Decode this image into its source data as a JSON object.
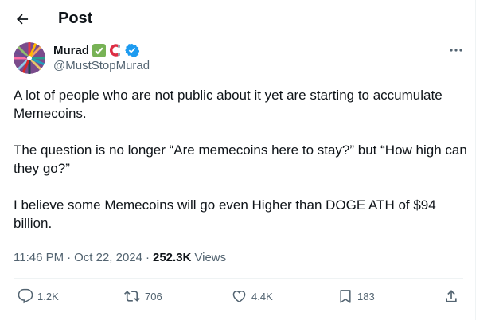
{
  "header": {
    "title": "Post"
  },
  "author": {
    "name": "Murad",
    "badge_emoji": "✅",
    "handle": "@MustStopMurad"
  },
  "post": {
    "paragraphs": [
      "A lot of people who are not public about it yet are starting to accumulate Memecoins.",
      "The question is no longer “Are memecoins here to stay?” but “How high can they go?”",
      "I believe some Memecoins will go even Higher than DOGE ATH of $94 billion."
    ],
    "time": "11:46 PM",
    "date": "Oct 22, 2024",
    "separator": "·",
    "views_count": "252.3K",
    "views_label": "Views"
  },
  "actions": {
    "replies": "1.2K",
    "reposts": "706",
    "likes": "4.4K",
    "bookmarks": "183"
  },
  "colors": {
    "text": "#0f1419",
    "secondary": "#536471",
    "verified": "#1d9bf0",
    "divider": "#eff3f4"
  }
}
